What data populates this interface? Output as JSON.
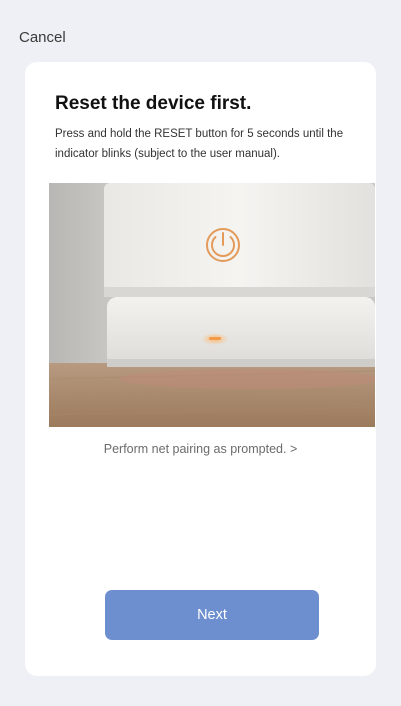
{
  "header": {
    "cancel_label": "Cancel"
  },
  "card": {
    "title": "Reset the device first.",
    "description": "Press and hold the RESET button for 5 seconds until the indicator blinks (subject to the user manual).",
    "help_link": "Perform net pairing as prompted. >",
    "next_label": "Next"
  },
  "colors": {
    "background": "#eef0f5",
    "card": "#ffffff",
    "primary_button": "#6d8fd0",
    "indicator_light": "#f29a4a"
  },
  "icons": {
    "power": "power-icon"
  }
}
